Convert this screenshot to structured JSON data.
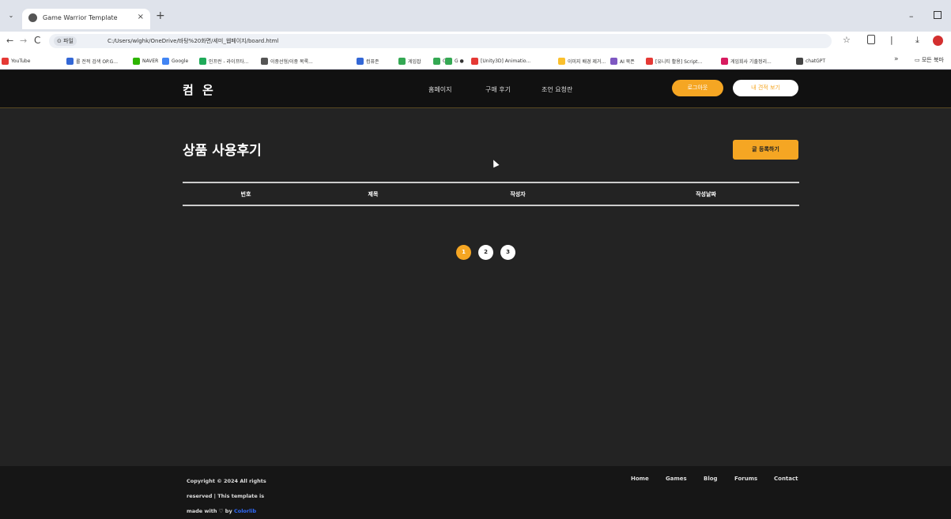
{
  "browser": {
    "tab_title": "Game Warrior Template",
    "tab_close": "×",
    "new_tab": "+",
    "tab_list": "⌄",
    "window_min": "–",
    "nav_back": "←",
    "nav_forward": "→",
    "nav_reload": "C",
    "site_chip": "⊙ 파일",
    "url": "C:/Users/wlghk/OneDrive/바탕%20화면/세미_웹페이지/board.html",
    "star": "☆",
    "puzzle_sep": "|",
    "download": "⤓",
    "bookmark_more": "»",
    "bookmark_folder": "▭ 모든 북마",
    "bookmarks": [
      {
        "label": "YouTube",
        "color": "#e53935"
      },
      {
        "label": "롤 전적 검색 OP.G...",
        "color": "#3367d6"
      },
      {
        "label": "NAVER",
        "color": "#2db400"
      },
      {
        "label": "Google",
        "color": "#4285f4"
      },
      {
        "label": "인프런 - 라이프타...",
        "color": "#1faa59"
      },
      {
        "label": "이중선형/이중 복록...",
        "color": "#555555"
      },
      {
        "label": "컴퓨존",
        "color": "#3367d6"
      },
      {
        "label": "게임잡",
        "color": "#34a853"
      },
      {
        "label": "G",
        "color": "#34a853"
      },
      {
        "label": "G ●",
        "color": "#34a853"
      },
      {
        "label": "[Unity3D] Animatio...",
        "color": "#e53935"
      },
      {
        "label": "이미지 배경 제거...",
        "color": "#fbc02d"
      },
      {
        "label": "AI 북픈",
        "color": "#7e57c2"
      },
      {
        "label": "[유니티 활용] Script...",
        "color": "#e53935"
      },
      {
        "label": "게임회사 기출정리...",
        "color": "#d81b60"
      },
      {
        "label": "chatGPT",
        "color": "#444444"
      }
    ]
  },
  "header": {
    "logo": "컴 온",
    "nav": [
      "홈페이지",
      "구매 후기",
      "조언 요청란"
    ],
    "login_button": "로그아웃",
    "cart_button": "내 견적 보기"
  },
  "main": {
    "title": "상품 사용후기",
    "write_button": "글 등록하기",
    "columns": [
      "번호",
      "제목",
      "작성자",
      "작성날짜"
    ],
    "pages": [
      "1",
      "2",
      "3"
    ],
    "active_page": "1"
  },
  "footer": {
    "copyright_line1": "Copyright © 2024 All rights",
    "copyright_line2": "reserved | This template is",
    "copyright_line3": "made with ♡ by",
    "credit": "Colorlib",
    "links": [
      "Home",
      "Games",
      "Blog",
      "Forums",
      "Contact"
    ]
  },
  "colors": {
    "accent": "#f5a623",
    "background": "#232323",
    "header_bg": "#111111"
  }
}
